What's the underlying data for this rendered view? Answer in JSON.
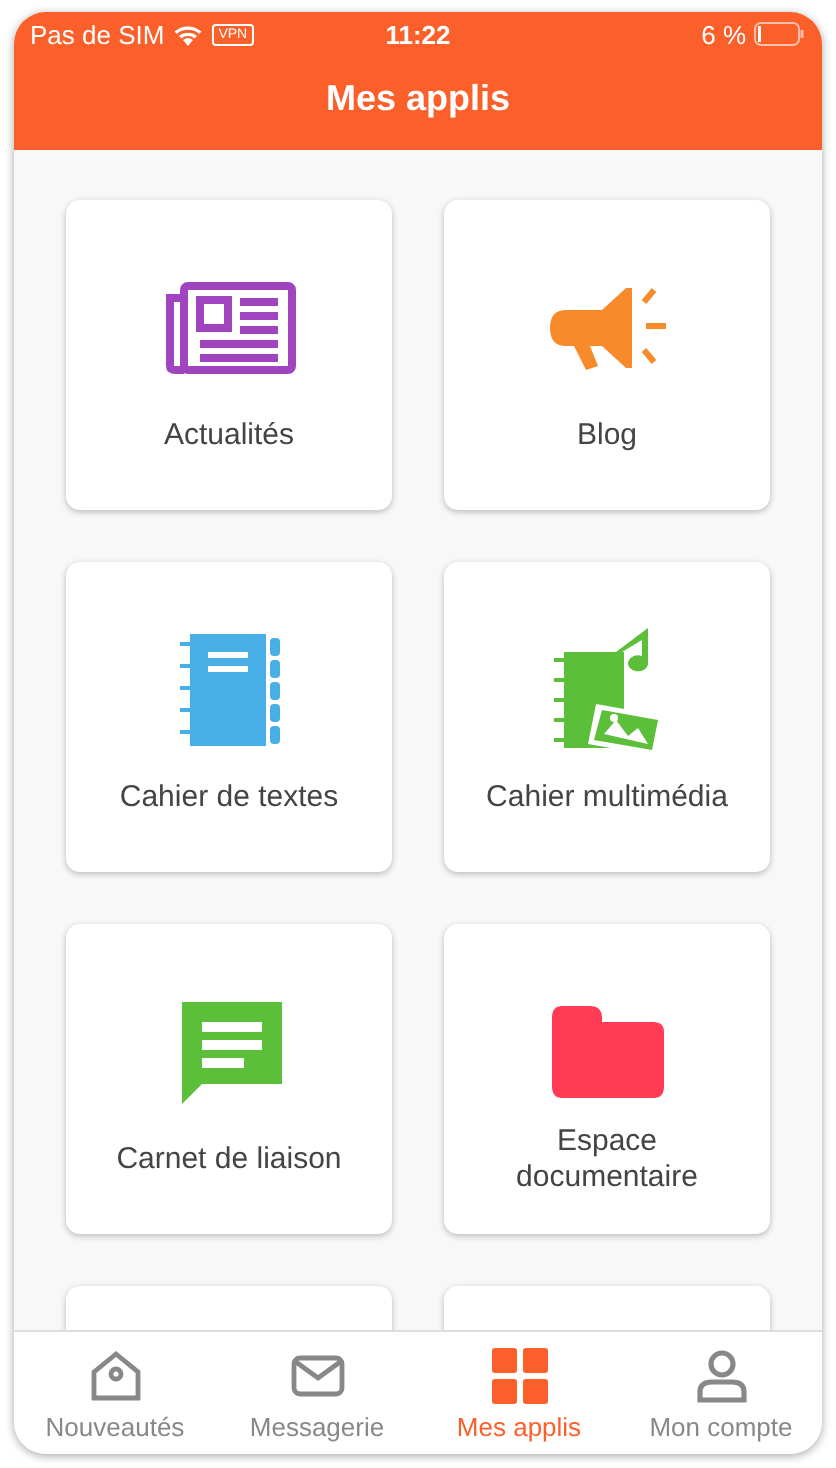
{
  "status_bar": {
    "carrier": "Pas de SIM",
    "vpn": "VPN",
    "time": "11:22",
    "battery": "6 %"
  },
  "header": {
    "title": "Mes applis"
  },
  "apps": [
    {
      "kind": "app",
      "label": "Actualités"
    },
    {
      "kind": "app",
      "label": "Blog"
    },
    {
      "kind": "app",
      "label": "Cahier de textes"
    },
    {
      "kind": "app",
      "label": "Cahier multimédia"
    },
    {
      "kind": "app",
      "label": "Carnet de liaison"
    },
    {
      "kind": "app",
      "label": "Espace documentaire"
    },
    {
      "kind": "cut"
    },
    {
      "kind": "cut"
    }
  ],
  "tab_bar": [
    {
      "label": "Nouveautés",
      "selected": false
    },
    {
      "label": "Messagerie",
      "selected": false
    },
    {
      "label": "Mes applis",
      "selected": true
    },
    {
      "label": "Mon compte",
      "selected": false
    }
  ]
}
